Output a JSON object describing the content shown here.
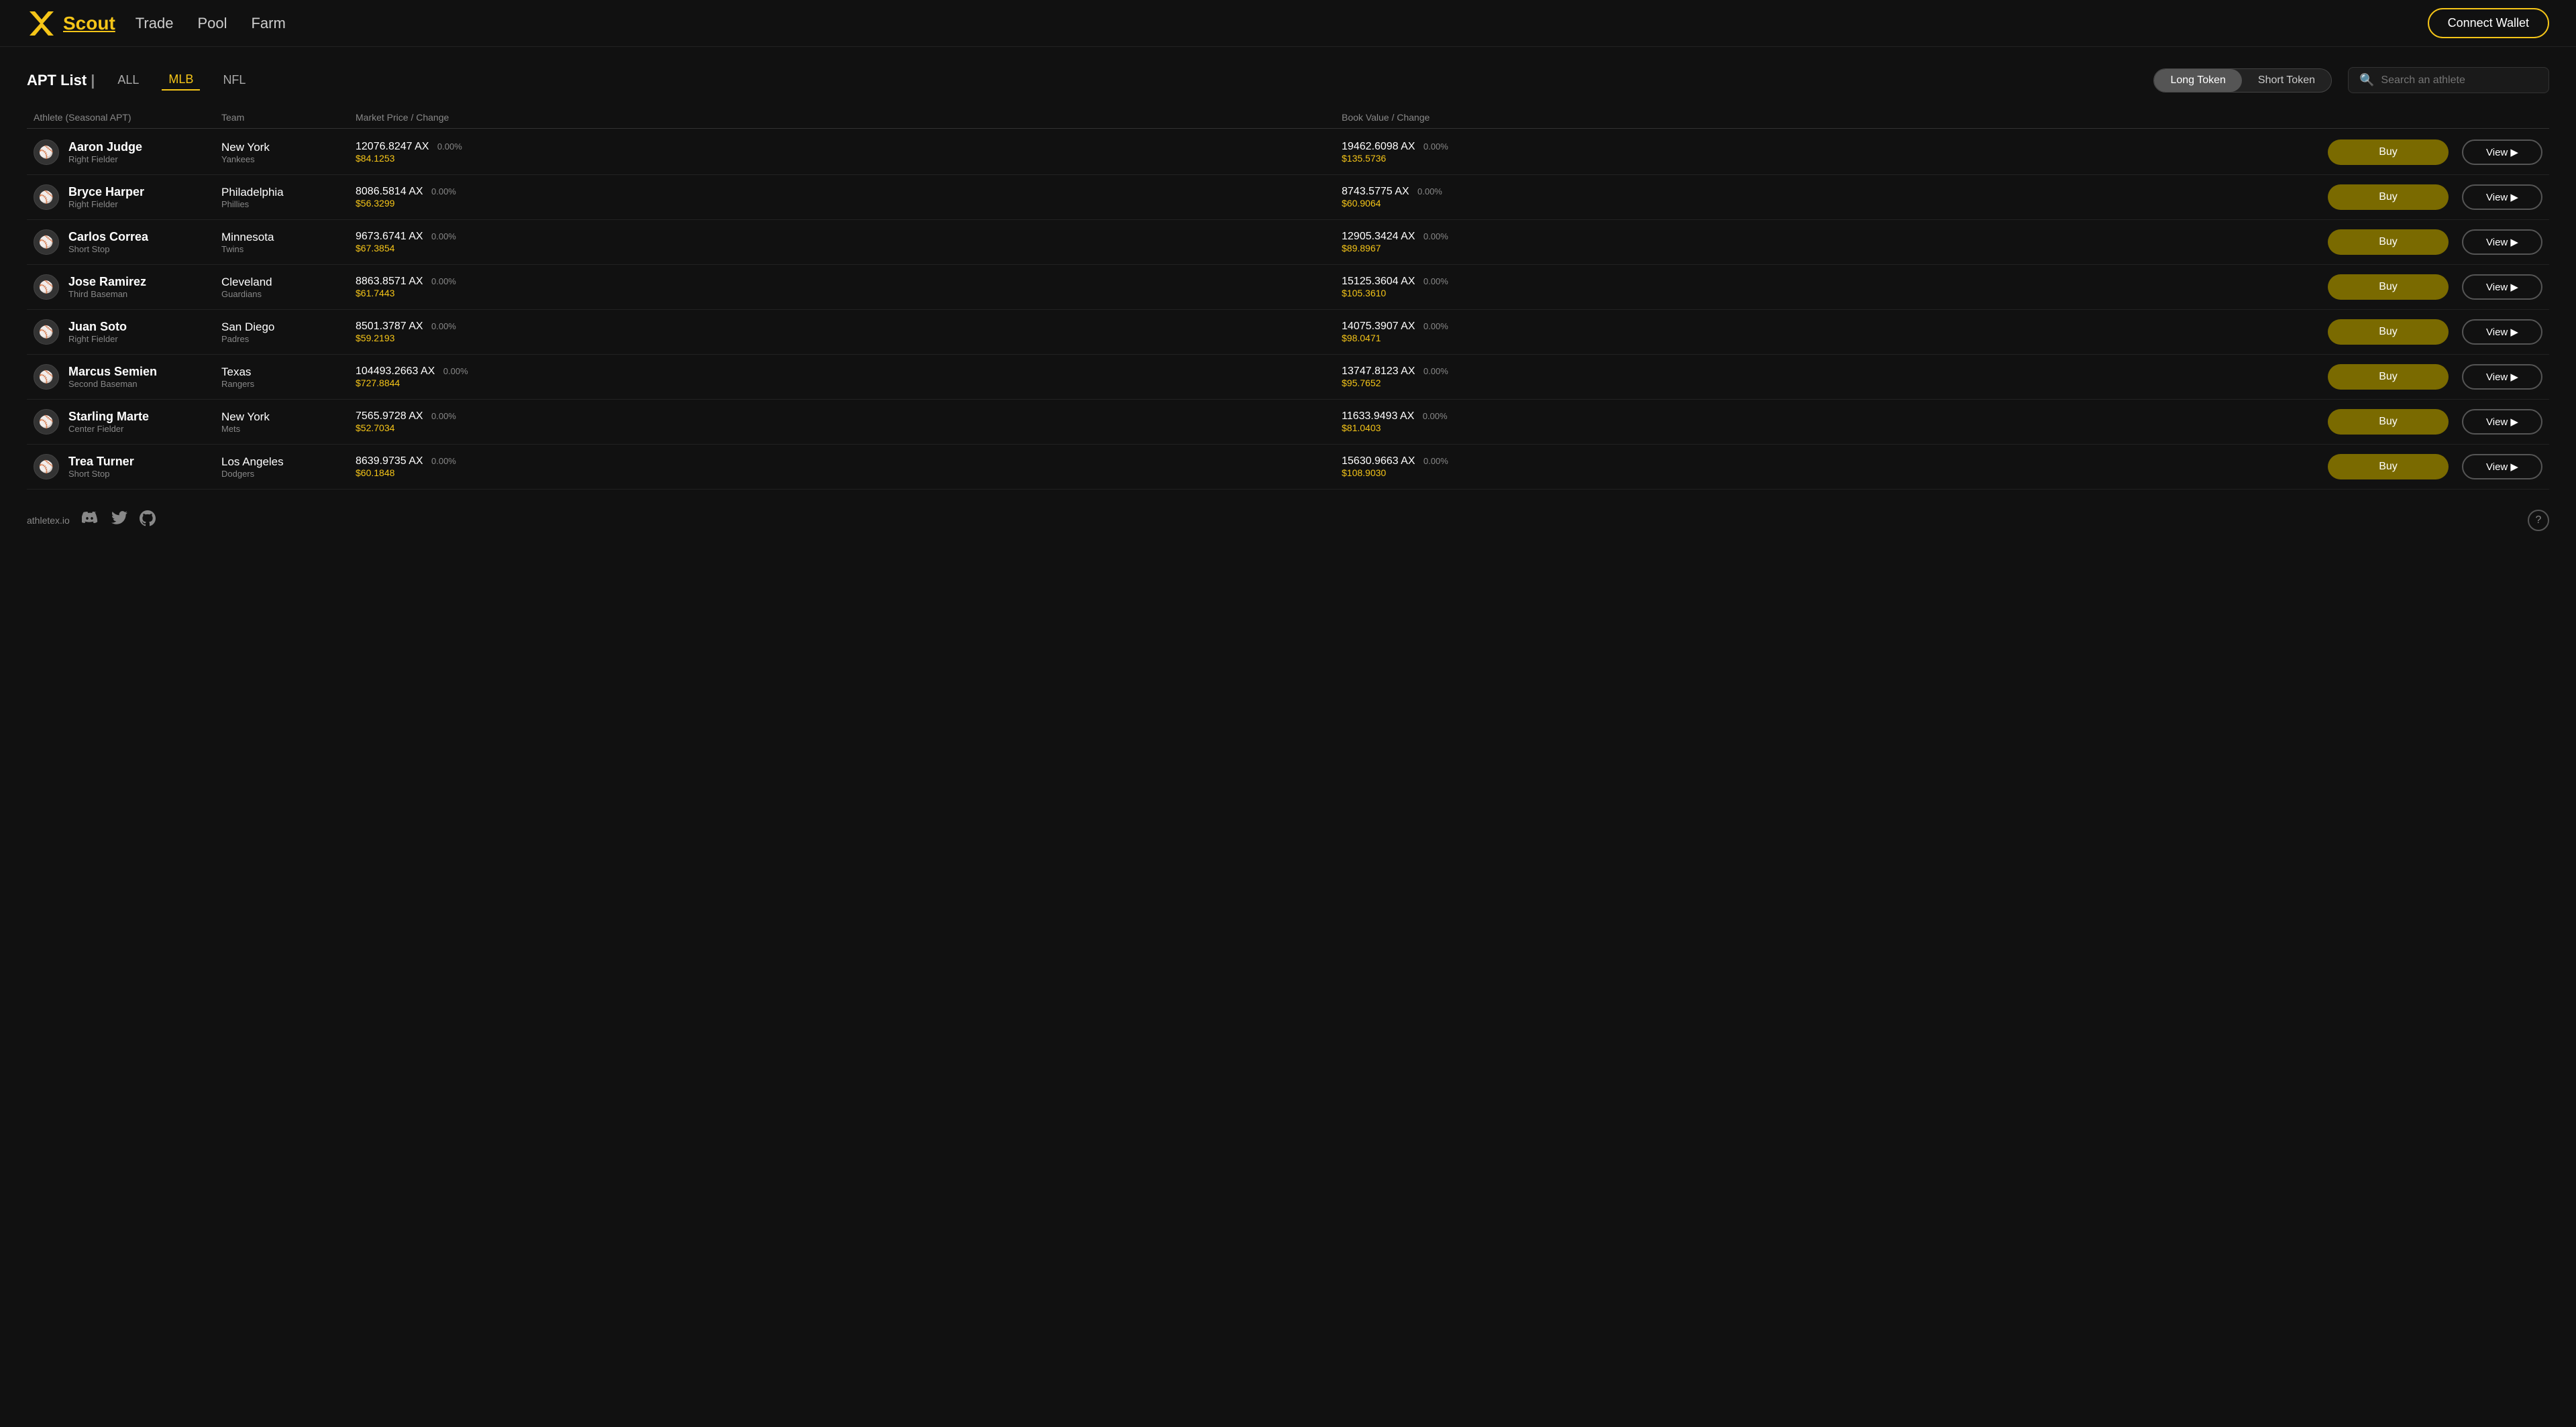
{
  "nav": {
    "logo_text": "Scout",
    "links": [
      {
        "label": "Scout",
        "active": true
      },
      {
        "label": "Trade",
        "active": false
      },
      {
        "label": "Pool",
        "active": false
      },
      {
        "label": "Farm",
        "active": false
      }
    ],
    "connect_wallet": "Connect Wallet"
  },
  "apt_list": {
    "title": "APT List",
    "pipe": "|",
    "filters": [
      {
        "label": "ALL",
        "active": false
      },
      {
        "label": "MLB",
        "active": true
      },
      {
        "label": "NFL",
        "active": false
      }
    ],
    "token_toggle": {
      "long": "Long Token",
      "short": "Short Token",
      "selected": "long"
    },
    "search_placeholder": "Search an athlete"
  },
  "table": {
    "headers": {
      "athlete": "Athlete (Seasonal APT)",
      "team": "Team",
      "market_price": "Market Price / Change",
      "book_value": "Book Value / Change"
    },
    "rows": [
      {
        "name": "Aaron Judge",
        "position": "Right Fielder",
        "team_city": "New York",
        "team_name": "Yankees",
        "market_ax": "12076.8247 AX",
        "market_change": "0.00%",
        "market_usd": "$84.1253",
        "book_ax": "19462.6098 AX",
        "book_change": "0.00%",
        "book_usd": "$135.5736",
        "buy_label": "Buy",
        "view_label": "View ▶"
      },
      {
        "name": "Bryce Harper",
        "position": "Right Fielder",
        "team_city": "Philadelphia",
        "team_name": "Phillies",
        "market_ax": "8086.5814 AX",
        "market_change": "0.00%",
        "market_usd": "$56.3299",
        "book_ax": "8743.5775 AX",
        "book_change": "0.00%",
        "book_usd": "$60.9064",
        "buy_label": "Buy",
        "view_label": "View ▶"
      },
      {
        "name": "Carlos Correa",
        "position": "Short Stop",
        "team_city": "Minnesota",
        "team_name": "Twins",
        "market_ax": "9673.6741 AX",
        "market_change": "0.00%",
        "market_usd": "$67.3854",
        "book_ax": "12905.3424 AX",
        "book_change": "0.00%",
        "book_usd": "$89.8967",
        "buy_label": "Buy",
        "view_label": "View ▶"
      },
      {
        "name": "Jose Ramirez",
        "position": "Third Baseman",
        "team_city": "Cleveland",
        "team_name": "Guardians",
        "market_ax": "8863.8571 AX",
        "market_change": "0.00%",
        "market_usd": "$61.7443",
        "book_ax": "15125.3604 AX",
        "book_change": "0.00%",
        "book_usd": "$105.3610",
        "buy_label": "Buy",
        "view_label": "View ▶"
      },
      {
        "name": "Juan Soto",
        "position": "Right Fielder",
        "team_city": "San Diego",
        "team_name": "Padres",
        "market_ax": "8501.3787 AX",
        "market_change": "0.00%",
        "market_usd": "$59.2193",
        "book_ax": "14075.3907 AX",
        "book_change": "0.00%",
        "book_usd": "$98.0471",
        "buy_label": "Buy",
        "view_label": "View ▶"
      },
      {
        "name": "Marcus Semien",
        "position": "Second Baseman",
        "team_city": "Texas",
        "team_name": "Rangers",
        "market_ax": "104493.2663 AX",
        "market_change": "0.00%",
        "market_usd": "$727.8844",
        "book_ax": "13747.8123 AX",
        "book_change": "0.00%",
        "book_usd": "$95.7652",
        "buy_label": "Buy",
        "view_label": "View ▶"
      },
      {
        "name": "Starling Marte",
        "position": "Center Fielder",
        "team_city": "New York",
        "team_name": "Mets",
        "market_ax": "7565.9728 AX",
        "market_change": "0.00%",
        "market_usd": "$52.7034",
        "book_ax": "11633.9493 AX",
        "book_change": "0.00%",
        "book_usd": "$81.0403",
        "buy_label": "Buy",
        "view_label": "View ▶"
      },
      {
        "name": "Trea Turner",
        "position": "Short Stop",
        "team_city": "Los Angeles",
        "team_name": "Dodgers",
        "market_ax": "8639.9735 AX",
        "market_change": "0.00%",
        "market_usd": "$60.1848",
        "book_ax": "15630.9663 AX",
        "book_change": "0.00%",
        "book_usd": "$108.9030",
        "buy_label": "Buy",
        "view_label": "View ▶"
      }
    ]
  },
  "footer": {
    "site": "athletex.io",
    "help": "?"
  }
}
